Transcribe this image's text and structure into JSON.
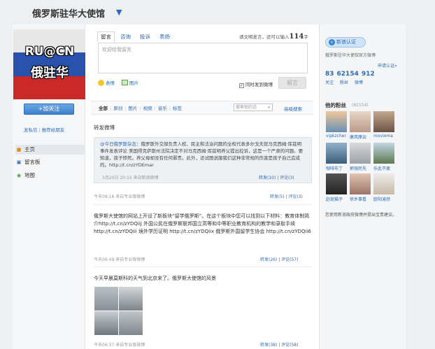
{
  "header": {
    "title": "俄罗斯驻华大使馆"
  },
  "avatar": {
    "line1": "RU@CN",
    "line2": "俄驻华"
  },
  "sidebar": {
    "follow_label": "+加关注",
    "link_private": "发私信",
    "link_recommend": "推荐给朋友",
    "nav": [
      {
        "label": "主页",
        "icon": "home-icon"
      },
      {
        "label": "留言板",
        "icon": "message-board-icon"
      },
      {
        "label": "地图",
        "icon": "map-icon"
      }
    ]
  },
  "composer": {
    "tabs": [
      "留言",
      "咨询",
      "投诉",
      "表扬"
    ],
    "counter_prefix": "请文明发言，还可以输入",
    "counter_value": "114",
    "counter_suffix": "字",
    "placeholder": "欢迎给我留言",
    "tool_emoticon": "表情",
    "tool_image": "图片",
    "sync_label": "同时发到微博",
    "send_label": "留言"
  },
  "filters": {
    "items": [
      "全部",
      "原创",
      "图片",
      "视频",
      "音乐",
      "标签"
    ],
    "search_placeholder": "搜索他的话",
    "advanced": "高级搜索"
  },
  "feed": {
    "section_title": "转发微博",
    "retweet": {
      "author": "@今日俄罗斯杂志",
      "text": "：俄罗斯外交部负责人权、民主和法治问题的全权代表多尔戈夫就马克西姆·库兹明事件发表评论 美国得克萨斯州法院决定不对马克西姆·库兹明养父提出控诉，这是一个严肃的问题。要知道，孩子惨死。养父母却没有任何罪责。此外，还试图说服我们这种非常规的伤害是孩子自己造成的。http://t.cn/zYDEmar",
      "meta": "3月20日 20:15  来自新浪微博",
      "actions": "转发(10) | 评论(3)"
    },
    "posts": [
      {
        "meta": "今天08:16  来自专业版微博",
        "actions": "转发(5) | 评论(3)",
        "text": ""
      },
      {
        "text": "俄罗斯大使馆的网站上开设了新板块“留学俄罗斯”。在这个板块中您可以找到以下材料：教育体制简介http://t.cn/zYDQiiJ 外国公民在俄罗斯联邦国立高等和中等职业教育机构的教学和录取手续http://t.cn/zYDQiii 境外学历证明 http://t.cn/zYDQiix 俄罗斯外国留学生协会 http://t.cn/zYDQii6",
        "meta": "今天06:49  来自专业版微博",
        "actions": "转发(26) | 评论(57)"
      },
      {
        "text": "今天早晨莫斯科的天气到北京来了。俄罗斯大使馆的风景",
        "meta": "今天06:37  来自专业版微博",
        "actions": "转发(38) | 评论(58)"
      }
    ]
  },
  "profile": {
    "verify_label": "新浪认证",
    "official_label": "俄罗斯驻华大使馆官方微博",
    "apply_label": "申请认证»",
    "follows": "83",
    "fans": "62154",
    "weibo": "912",
    "follows_label": "关注",
    "fans_label": "粉丝",
    "weibo_label": "微博"
  },
  "fans_panel": {
    "title": "他的粉丝",
    "count": "(62154)",
    "fans": [
      {
        "name": "vipkzcher"
      },
      {
        "name": "廉风摩云"
      },
      {
        "name": "moviema"
      },
      {
        "name": "咖啡布丁"
      },
      {
        "name": "郭强民先"
      },
      {
        "name": "乐此不疲"
      },
      {
        "name": "赵斑猫子"
      },
      {
        "name": "徐乡事看"
      },
      {
        "name": "欧阳渝然"
      }
    ],
    "notice": "您使用新浪政府微博并提出宝贵建议。"
  }
}
